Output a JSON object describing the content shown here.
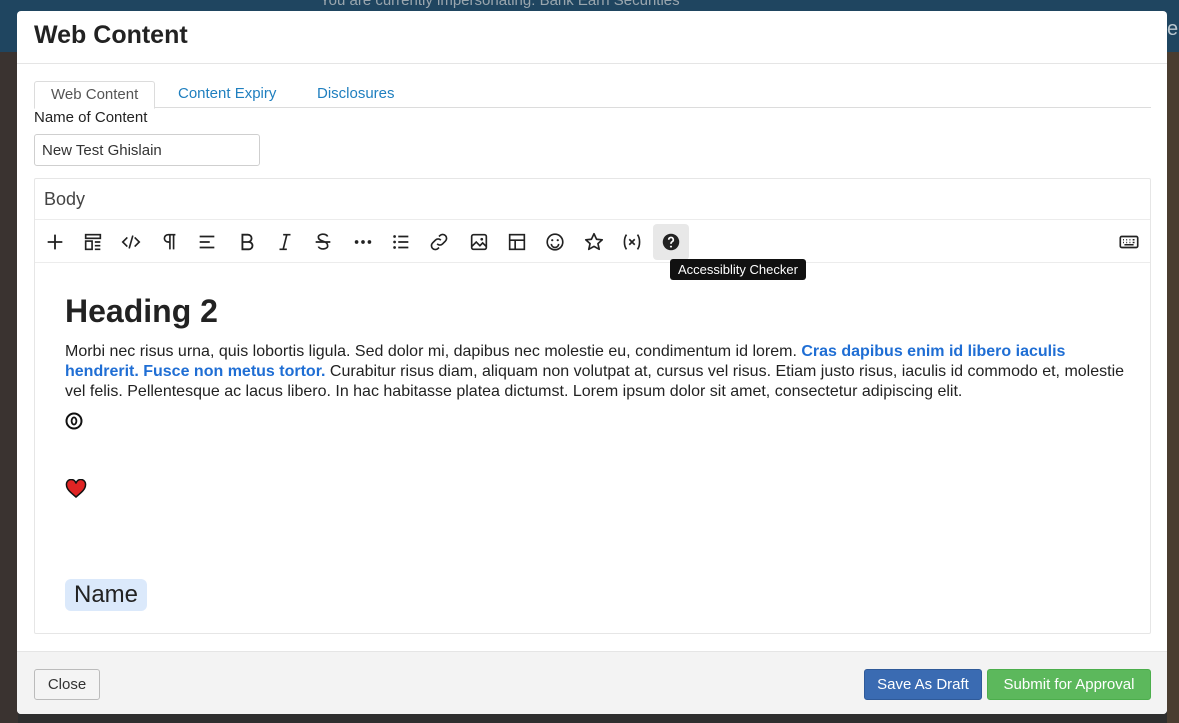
{
  "backdrop": {
    "banner_text": "You are currently impersonating: Bank Earn Securities"
  },
  "modal": {
    "title": "Web Content"
  },
  "tabs": [
    {
      "label": "Web Content",
      "active": true
    },
    {
      "label": "Content Expiry",
      "active": false
    },
    {
      "label": "Disclosures",
      "active": false
    }
  ],
  "name_field": {
    "label": "Name of Content",
    "value": "New Test Ghislain"
  },
  "editor": {
    "label": "Body",
    "toolbar": [
      {
        "icon": "plus-icon",
        "name": "insert"
      },
      {
        "icon": "blocks-icon",
        "name": "blocks"
      },
      {
        "icon": "code-icon",
        "name": "code-view"
      },
      {
        "icon": "paragraph-icon",
        "name": "paragraph-format"
      },
      {
        "icon": "align-left-icon",
        "name": "align"
      },
      {
        "icon": "bold-icon",
        "name": "bold"
      },
      {
        "icon": "italic-icon",
        "name": "italic"
      },
      {
        "icon": "strikethrough-icon",
        "name": "strikethrough"
      },
      {
        "icon": "more-icon",
        "name": "more"
      },
      {
        "icon": "bulleted-list-icon",
        "name": "list"
      },
      {
        "icon": "link-icon",
        "name": "link"
      },
      {
        "icon": "image-icon",
        "name": "image"
      },
      {
        "icon": "table-icon",
        "name": "table"
      },
      {
        "icon": "emoji-icon",
        "name": "emoticons"
      },
      {
        "icon": "star-icon",
        "name": "special"
      },
      {
        "icon": "variable-icon",
        "name": "variables"
      },
      {
        "icon": "help-icon",
        "name": "accessibility-checker"
      },
      {
        "icon": "keyboard-icon",
        "name": "keyboard"
      }
    ],
    "tooltip": "Accessiblity Checker",
    "heading": "Heading 2",
    "paragraph_start": "Morbi nec risus urna, quis lobortis ligula. Sed dolor mi, dapibus nec molestie eu, condimentum id lorem. ",
    "paragraph_highlight": "Cras dapibus enim id libero iaculis hendrerit. Fusce non metus tortor.",
    "paragraph_end": " Curabitur risus diam, aliquam non volutpat at, cursus vel risus. Etiam justo risus, iaculis id commodo et, molestie vel felis. Pellentesque ac lacus libero. In hac habitasse platea dictumst. Lorem ipsum dolor sit amet, consectetur adipiscing elit.",
    "chip_text": "Name"
  },
  "footer": {
    "close_label": "Close",
    "draft_label": "Save As Draft",
    "submit_label": "Submit for Approval"
  },
  "colors": {
    "link": "#1f7fbf",
    "highlight_text": "#1f6ed4",
    "draft_button": "#3a6bb2",
    "submit_button": "#5cb85c",
    "chip_bg": "#dbe9fb",
    "heart": "#e02424"
  }
}
